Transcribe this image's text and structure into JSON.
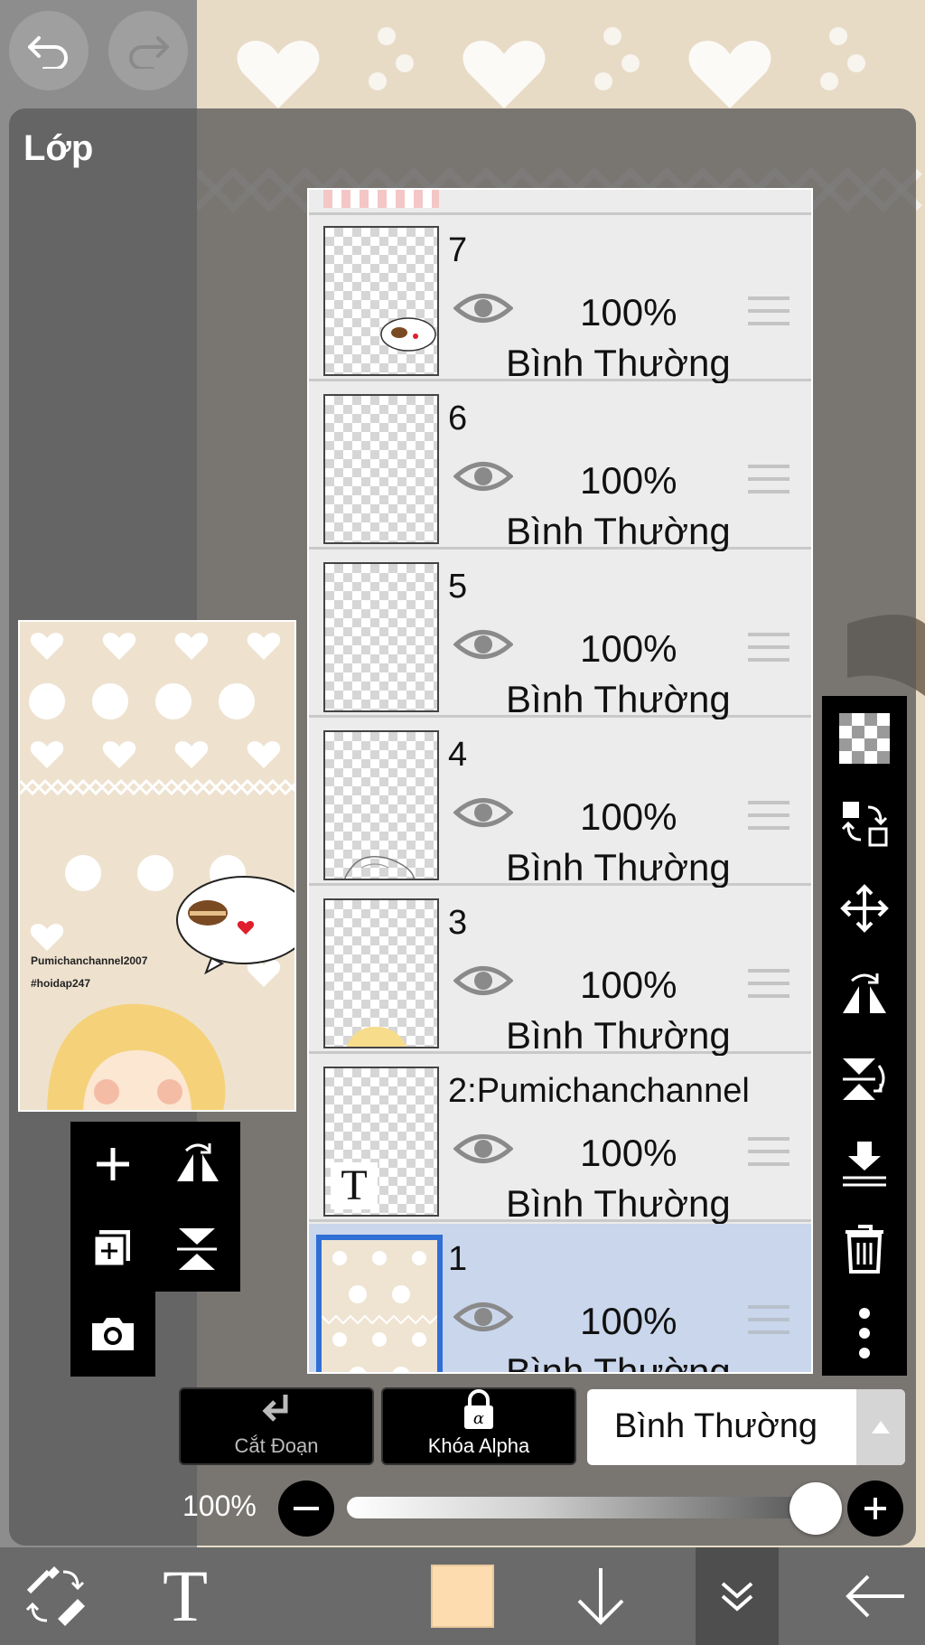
{
  "app": {
    "panel_title": "Lớp",
    "undo_icon": "undo-icon",
    "redo_icon": "redo-icon"
  },
  "preview": {
    "watermark_line1": "Pumichanchannel2007",
    "watermark_line2": "#hoidap247"
  },
  "layers": [
    {
      "name": "7",
      "opacity": "100%",
      "mode": "Bình Thường",
      "selected": false,
      "thumb": "speech-bubble"
    },
    {
      "name": "6",
      "opacity": "100%",
      "mode": "Bình Thường",
      "selected": false,
      "thumb": "empty"
    },
    {
      "name": "5",
      "opacity": "100%",
      "mode": "Bình Thường",
      "selected": false,
      "thumb": "empty"
    },
    {
      "name": "4",
      "opacity": "100%",
      "mode": "Bình Thường",
      "selected": false,
      "thumb": "sketch"
    },
    {
      "name": "3",
      "opacity": "100%",
      "mode": "Bình Thường",
      "selected": false,
      "thumb": "hair"
    },
    {
      "name": "2:Pumichanchannel",
      "opacity": "100%",
      "mode": "Bình Thường",
      "selected": false,
      "thumb": "text"
    },
    {
      "name": "1",
      "opacity": "100%",
      "mode": "Bình Thường",
      "selected": true,
      "thumb": "pattern"
    }
  ],
  "controls": {
    "clipping_label": "Cắt Đoạn",
    "alpha_lock_label": "Khóa Alpha",
    "blend_mode": "Bình Thường",
    "opacity_label": "100%",
    "opacity_value": 1.0
  },
  "colors": {
    "current_color": "#fddcb0",
    "selection_blue": "#2f6fd6"
  }
}
